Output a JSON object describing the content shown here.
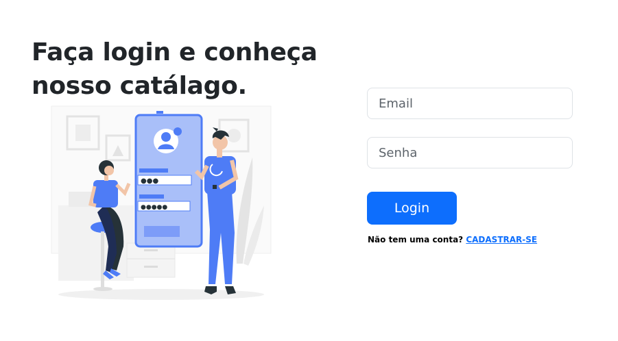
{
  "headline": "Faça login e conheça nosso catálago.",
  "illustration": {
    "icon": "login-illustration",
    "colors": {
      "primary": "#4e7cf6",
      "light": "#a9bff9",
      "dark": "#263238",
      "grey": "#e6e6e6"
    }
  },
  "form": {
    "email_placeholder": "Email",
    "password_placeholder": "Senha",
    "login_label": "Login"
  },
  "signup": {
    "prompt": "Não tem uma conta?",
    "link_label": "CADASTRAR-SE"
  },
  "colors": {
    "accent": "#0d6efd",
    "text": "#212529",
    "border": "#dee2e6"
  }
}
